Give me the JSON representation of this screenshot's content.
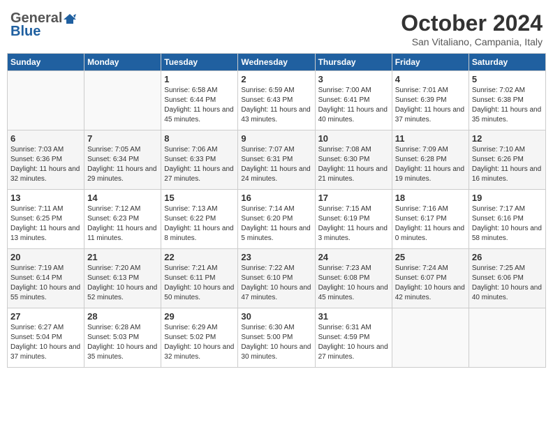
{
  "header": {
    "logo_general": "General",
    "logo_blue": "Blue",
    "month_title": "October 2024",
    "location": "San Vitaliano, Campania, Italy"
  },
  "weekdays": [
    "Sunday",
    "Monday",
    "Tuesday",
    "Wednesday",
    "Thursday",
    "Friday",
    "Saturday"
  ],
  "weeks": [
    [
      {
        "day": "",
        "sunrise": "",
        "sunset": "",
        "daylight": ""
      },
      {
        "day": "",
        "sunrise": "",
        "sunset": "",
        "daylight": ""
      },
      {
        "day": "1",
        "sunrise": "Sunrise: 6:58 AM",
        "sunset": "Sunset: 6:44 PM",
        "daylight": "Daylight: 11 hours and 45 minutes."
      },
      {
        "day": "2",
        "sunrise": "Sunrise: 6:59 AM",
        "sunset": "Sunset: 6:43 PM",
        "daylight": "Daylight: 11 hours and 43 minutes."
      },
      {
        "day": "3",
        "sunrise": "Sunrise: 7:00 AM",
        "sunset": "Sunset: 6:41 PM",
        "daylight": "Daylight: 11 hours and 40 minutes."
      },
      {
        "day": "4",
        "sunrise": "Sunrise: 7:01 AM",
        "sunset": "Sunset: 6:39 PM",
        "daylight": "Daylight: 11 hours and 37 minutes."
      },
      {
        "day": "5",
        "sunrise": "Sunrise: 7:02 AM",
        "sunset": "Sunset: 6:38 PM",
        "daylight": "Daylight: 11 hours and 35 minutes."
      }
    ],
    [
      {
        "day": "6",
        "sunrise": "Sunrise: 7:03 AM",
        "sunset": "Sunset: 6:36 PM",
        "daylight": "Daylight: 11 hours and 32 minutes."
      },
      {
        "day": "7",
        "sunrise": "Sunrise: 7:05 AM",
        "sunset": "Sunset: 6:34 PM",
        "daylight": "Daylight: 11 hours and 29 minutes."
      },
      {
        "day": "8",
        "sunrise": "Sunrise: 7:06 AM",
        "sunset": "Sunset: 6:33 PM",
        "daylight": "Daylight: 11 hours and 27 minutes."
      },
      {
        "day": "9",
        "sunrise": "Sunrise: 7:07 AM",
        "sunset": "Sunset: 6:31 PM",
        "daylight": "Daylight: 11 hours and 24 minutes."
      },
      {
        "day": "10",
        "sunrise": "Sunrise: 7:08 AM",
        "sunset": "Sunset: 6:30 PM",
        "daylight": "Daylight: 11 hours and 21 minutes."
      },
      {
        "day": "11",
        "sunrise": "Sunrise: 7:09 AM",
        "sunset": "Sunset: 6:28 PM",
        "daylight": "Daylight: 11 hours and 19 minutes."
      },
      {
        "day": "12",
        "sunrise": "Sunrise: 7:10 AM",
        "sunset": "Sunset: 6:26 PM",
        "daylight": "Daylight: 11 hours and 16 minutes."
      }
    ],
    [
      {
        "day": "13",
        "sunrise": "Sunrise: 7:11 AM",
        "sunset": "Sunset: 6:25 PM",
        "daylight": "Daylight: 11 hours and 13 minutes."
      },
      {
        "day": "14",
        "sunrise": "Sunrise: 7:12 AM",
        "sunset": "Sunset: 6:23 PM",
        "daylight": "Daylight: 11 hours and 11 minutes."
      },
      {
        "day": "15",
        "sunrise": "Sunrise: 7:13 AM",
        "sunset": "Sunset: 6:22 PM",
        "daylight": "Daylight: 11 hours and 8 minutes."
      },
      {
        "day": "16",
        "sunrise": "Sunrise: 7:14 AM",
        "sunset": "Sunset: 6:20 PM",
        "daylight": "Daylight: 11 hours and 5 minutes."
      },
      {
        "day": "17",
        "sunrise": "Sunrise: 7:15 AM",
        "sunset": "Sunset: 6:19 PM",
        "daylight": "Daylight: 11 hours and 3 minutes."
      },
      {
        "day": "18",
        "sunrise": "Sunrise: 7:16 AM",
        "sunset": "Sunset: 6:17 PM",
        "daylight": "Daylight: 11 hours and 0 minutes."
      },
      {
        "day": "19",
        "sunrise": "Sunrise: 7:17 AM",
        "sunset": "Sunset: 6:16 PM",
        "daylight": "Daylight: 10 hours and 58 minutes."
      }
    ],
    [
      {
        "day": "20",
        "sunrise": "Sunrise: 7:19 AM",
        "sunset": "Sunset: 6:14 PM",
        "daylight": "Daylight: 10 hours and 55 minutes."
      },
      {
        "day": "21",
        "sunrise": "Sunrise: 7:20 AM",
        "sunset": "Sunset: 6:13 PM",
        "daylight": "Daylight: 10 hours and 52 minutes."
      },
      {
        "day": "22",
        "sunrise": "Sunrise: 7:21 AM",
        "sunset": "Sunset: 6:11 PM",
        "daylight": "Daylight: 10 hours and 50 minutes."
      },
      {
        "day": "23",
        "sunrise": "Sunrise: 7:22 AM",
        "sunset": "Sunset: 6:10 PM",
        "daylight": "Daylight: 10 hours and 47 minutes."
      },
      {
        "day": "24",
        "sunrise": "Sunrise: 7:23 AM",
        "sunset": "Sunset: 6:08 PM",
        "daylight": "Daylight: 10 hours and 45 minutes."
      },
      {
        "day": "25",
        "sunrise": "Sunrise: 7:24 AM",
        "sunset": "Sunset: 6:07 PM",
        "daylight": "Daylight: 10 hours and 42 minutes."
      },
      {
        "day": "26",
        "sunrise": "Sunrise: 7:25 AM",
        "sunset": "Sunset: 6:06 PM",
        "daylight": "Daylight: 10 hours and 40 minutes."
      }
    ],
    [
      {
        "day": "27",
        "sunrise": "Sunrise: 6:27 AM",
        "sunset": "Sunset: 5:04 PM",
        "daylight": "Daylight: 10 hours and 37 minutes."
      },
      {
        "day": "28",
        "sunrise": "Sunrise: 6:28 AM",
        "sunset": "Sunset: 5:03 PM",
        "daylight": "Daylight: 10 hours and 35 minutes."
      },
      {
        "day": "29",
        "sunrise": "Sunrise: 6:29 AM",
        "sunset": "Sunset: 5:02 PM",
        "daylight": "Daylight: 10 hours and 32 minutes."
      },
      {
        "day": "30",
        "sunrise": "Sunrise: 6:30 AM",
        "sunset": "Sunset: 5:00 PM",
        "daylight": "Daylight: 10 hours and 30 minutes."
      },
      {
        "day": "31",
        "sunrise": "Sunrise: 6:31 AM",
        "sunset": "Sunset: 4:59 PM",
        "daylight": "Daylight: 10 hours and 27 minutes."
      },
      {
        "day": "",
        "sunrise": "",
        "sunset": "",
        "daylight": ""
      },
      {
        "day": "",
        "sunrise": "",
        "sunset": "",
        "daylight": ""
      }
    ]
  ]
}
